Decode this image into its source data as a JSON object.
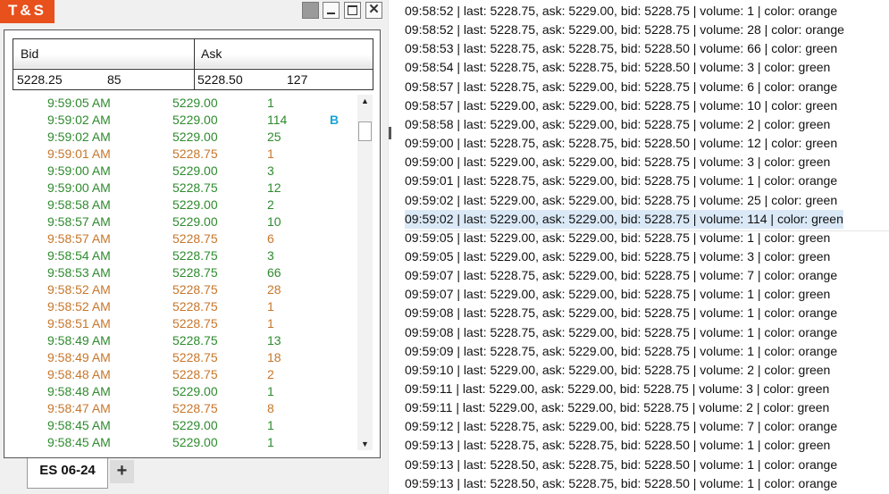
{
  "ts_window": {
    "title": "T&S",
    "close_glyph": "✕",
    "quote": {
      "bid_header": "Bid",
      "ask_header": "Ask",
      "bid_price": "5228.25",
      "bid_size": "85",
      "ask_price": "5228.50",
      "ask_size": "127"
    },
    "trades": [
      {
        "time": "9:59:05 AM",
        "price": "5229.00",
        "volume": "1",
        "mark": "",
        "color": "green"
      },
      {
        "time": "9:59:02 AM",
        "price": "5229.00",
        "volume": "114",
        "mark": "B",
        "color": "green"
      },
      {
        "time": "9:59:02 AM",
        "price": "5229.00",
        "volume": "25",
        "mark": "",
        "color": "green"
      },
      {
        "time": "9:59:01 AM",
        "price": "5228.75",
        "volume": "1",
        "mark": "",
        "color": "orange"
      },
      {
        "time": "9:59:00 AM",
        "price": "5229.00",
        "volume": "3",
        "mark": "",
        "color": "green"
      },
      {
        "time": "9:59:00 AM",
        "price": "5228.75",
        "volume": "12",
        "mark": "",
        "color": "green"
      },
      {
        "time": "9:58:58 AM",
        "price": "5229.00",
        "volume": "2",
        "mark": "",
        "color": "green"
      },
      {
        "time": "9:58:57 AM",
        "price": "5229.00",
        "volume": "10",
        "mark": "",
        "color": "green"
      },
      {
        "time": "9:58:57 AM",
        "price": "5228.75",
        "volume": "6",
        "mark": "",
        "color": "orange"
      },
      {
        "time": "9:58:54 AM",
        "price": "5228.75",
        "volume": "3",
        "mark": "",
        "color": "green"
      },
      {
        "time": "9:58:53 AM",
        "price": "5228.75",
        "volume": "66",
        "mark": "",
        "color": "green"
      },
      {
        "time": "9:58:52 AM",
        "price": "5228.75",
        "volume": "28",
        "mark": "",
        "color": "orange"
      },
      {
        "time": "9:58:52 AM",
        "price": "5228.75",
        "volume": "1",
        "mark": "",
        "color": "orange"
      },
      {
        "time": "9:58:51 AM",
        "price": "5228.75",
        "volume": "1",
        "mark": "",
        "color": "orange"
      },
      {
        "time": "9:58:49 AM",
        "price": "5228.75",
        "volume": "13",
        "mark": "",
        "color": "green"
      },
      {
        "time": "9:58:49 AM",
        "price": "5228.75",
        "volume": "18",
        "mark": "",
        "color": "orange"
      },
      {
        "time": "9:58:48 AM",
        "price": "5228.75",
        "volume": "2",
        "mark": "",
        "color": "orange"
      },
      {
        "time": "9:58:48 AM",
        "price": "5229.00",
        "volume": "1",
        "mark": "",
        "color": "green"
      },
      {
        "time": "9:58:47 AM",
        "price": "5228.75",
        "volume": "8",
        "mark": "",
        "color": "orange"
      },
      {
        "time": "9:58:45 AM",
        "price": "5229.00",
        "volume": "1",
        "mark": "",
        "color": "green"
      },
      {
        "time": "9:58:45 AM",
        "price": "5229.00",
        "volume": "1",
        "mark": "",
        "color": "green"
      }
    ],
    "tabs": [
      {
        "label": "ES 06-24"
      }
    ],
    "add_tab_label": "+"
  },
  "colors": {
    "green": "#2e8b2e",
    "orange": "#c8762a",
    "buy_mark": "#1aa4d6",
    "title_bg": "#e8501c"
  },
  "log": {
    "selected_index": 11,
    "lines": [
      "09:58:52 | last: 5228.75, ask: 5229.00, bid: 5228.75 | volume: 1 | color: orange",
      "09:58:52 | last: 5228.75, ask: 5229.00, bid: 5228.75 | volume: 28 | color: orange",
      "09:58:53 | last: 5228.75, ask: 5228.75, bid: 5228.50 | volume: 66 | color: green",
      "09:58:54 | last: 5228.75, ask: 5228.75, bid: 5228.50 | volume: 3 | color: green",
      "09:58:57 | last: 5228.75, ask: 5229.00, bid: 5228.75 | volume: 6 | color: orange",
      "09:58:57 | last: 5229.00, ask: 5229.00, bid: 5228.75 | volume: 10 | color: green",
      "09:58:58 | last: 5229.00, ask: 5229.00, bid: 5228.75 | volume: 2 | color: green",
      "09:59:00 | last: 5228.75, ask: 5228.75, bid: 5228.50 | volume: 12 | color: green",
      "09:59:00 | last: 5229.00, ask: 5229.00, bid: 5228.75 | volume: 3 | color: green",
      "09:59:01 | last: 5228.75, ask: 5229.00, bid: 5228.75 | volume: 1 | color: orange",
      "09:59:02 | last: 5229.00, ask: 5229.00, bid: 5228.75 | volume: 25 | color: green",
      "09:59:02 | last: 5229.00, ask: 5229.00, bid: 5228.75 | volume: 114 | color: green",
      "09:59:05 | last: 5229.00, ask: 5229.00, bid: 5228.75 | volume: 1 | color: green",
      "09:59:05 | last: 5229.00, ask: 5229.00, bid: 5228.75 | volume: 3 | color: green",
      "09:59:07 | last: 5228.75, ask: 5229.00, bid: 5228.75 | volume: 7 | color: orange",
      "09:59:07 | last: 5229.00, ask: 5229.00, bid: 5228.75 | volume: 1 | color: green",
      "09:59:08 | last: 5228.75, ask: 5229.00, bid: 5228.75 | volume: 1 | color: orange",
      "09:59:08 | last: 5228.75, ask: 5229.00, bid: 5228.75 | volume: 1 | color: orange",
      "09:59:09 | last: 5228.75, ask: 5229.00, bid: 5228.75 | volume: 1 | color: orange",
      "09:59:10 | last: 5229.00, ask: 5229.00, bid: 5228.75 | volume: 2 | color: green",
      "09:59:11 | last: 5229.00, ask: 5229.00, bid: 5228.75 | volume: 3 | color: green",
      "09:59:11 | last: 5229.00, ask: 5229.00, bid: 5228.75 | volume: 2 | color: green",
      "09:59:12 | last: 5228.75, ask: 5229.00, bid: 5228.75 | volume: 7 | color: orange",
      "09:59:13 | last: 5228.75, ask: 5228.75, bid: 5228.50 | volume: 1 | color: green",
      "09:59:13 | last: 5228.50, ask: 5228.75, bid: 5228.50 | volume: 1 | color: orange",
      "09:59:13 | last: 5228.50, ask: 5228.75, bid: 5228.50 | volume: 1 | color: orange"
    ]
  }
}
